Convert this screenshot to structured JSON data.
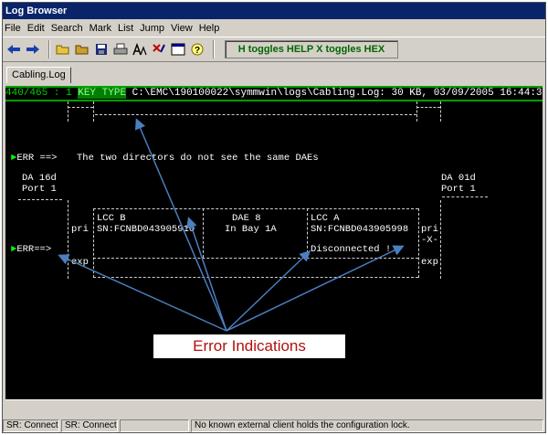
{
  "window": {
    "title": "Log Browser"
  },
  "menu": {
    "items": [
      "File",
      "Edit",
      "Search",
      "Mark",
      "List",
      "Jump",
      "View",
      "Help"
    ]
  },
  "toolbar": {
    "icons": [
      "arrow-left-icon",
      "arrow-right-icon",
      "folder-open-icon",
      "folder-icon",
      "floppy-icon",
      "print-icon",
      "font-icon",
      "filter-icon",
      "window-icon",
      "help-icon"
    ],
    "hint": "H toggles HELP  X toggles HEX"
  },
  "tabs": [
    {
      "label": "Cabling.Log"
    }
  ],
  "pathbar": {
    "line_position": "440/465 : 1",
    "mode": "KEY TYPE",
    "file_info": "C:\\EMC\\190100022\\symmwin\\logs\\Cabling.Log: 30 KB, 03/09/2005 16:44:30"
  },
  "console": {
    "err1_marker": "ERR ==>",
    "err1_message": "The two directors do not see the same DAEs",
    "left_director": "DA 16d",
    "left_port": "Port 1",
    "right_director": "DA 01d",
    "right_port": "Port 1",
    "lcc_b_label": "LCC B",
    "lcc_b_sn": "SN:FCNBD043905910",
    "dae_label": "DAE 8",
    "dae_bay": "In Bay 1A",
    "lcc_a_label": "LCC A",
    "lcc_a_sn": "SN:FCNBD043905998",
    "lcc_a_status": "Disconnected !",
    "pri_left": "pri",
    "pri_right": "pri",
    "x_mark": "-X-",
    "exp_left": "exp",
    "exp_right": "exp",
    "err2_marker": "ERR==>"
  },
  "annotation": {
    "callout": "Error Indications",
    "arrow_color": "#4a7fc0",
    "text_color": "#b01010"
  },
  "statusbar": {
    "cells": [
      "SR: Connect",
      "SR: Connect",
      "",
      "No known external client holds the configuration lock."
    ]
  }
}
